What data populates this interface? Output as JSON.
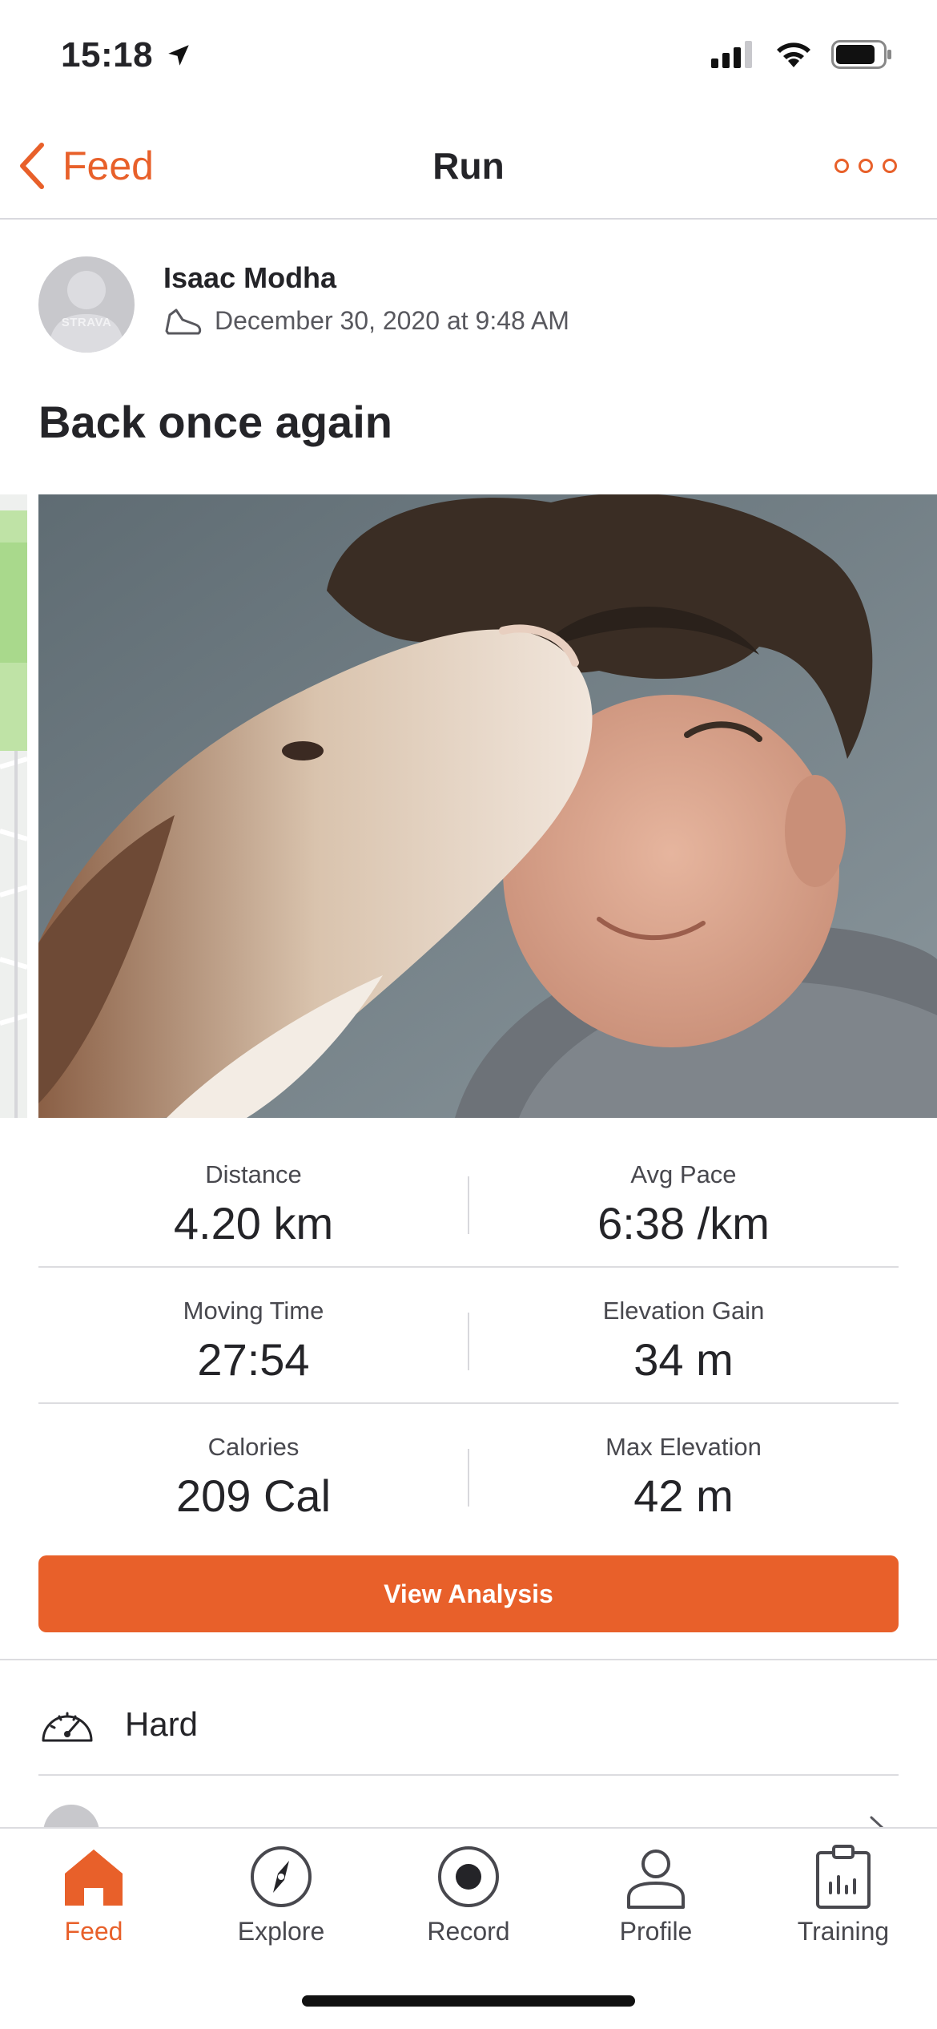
{
  "status_bar": {
    "time": "15:18"
  },
  "nav": {
    "back_label": "Feed",
    "title": "Run"
  },
  "athlete": {
    "name": "Isaac Modha",
    "avatar_text": "STRAVA",
    "datetime": "December 30, 2020 at 9:48 AM"
  },
  "activity": {
    "title": "Back once again"
  },
  "stats": [
    {
      "label": "Distance",
      "value": "4.20 km"
    },
    {
      "label": "Avg Pace",
      "value": "6:38 /km"
    },
    {
      "label": "Moving Time",
      "value": "27:54"
    },
    {
      "label": "Elevation Gain",
      "value": "34 m"
    },
    {
      "label": "Calories",
      "value": "209 Cal"
    },
    {
      "label": "Max Elevation",
      "value": "42 m"
    }
  ],
  "view_analysis_label": "View Analysis",
  "perceived_effort": "Hard",
  "tabs": [
    {
      "label": "Feed",
      "icon": "home-icon"
    },
    {
      "label": "Explore",
      "icon": "compass-icon"
    },
    {
      "label": "Record",
      "icon": "record-icon"
    },
    {
      "label": "Profile",
      "icon": "person-icon"
    },
    {
      "label": "Training",
      "icon": "clipboard-chart-icon"
    }
  ],
  "colors": {
    "accent": "#e8602a",
    "text": "#242428",
    "divider": "#dcdce0"
  }
}
